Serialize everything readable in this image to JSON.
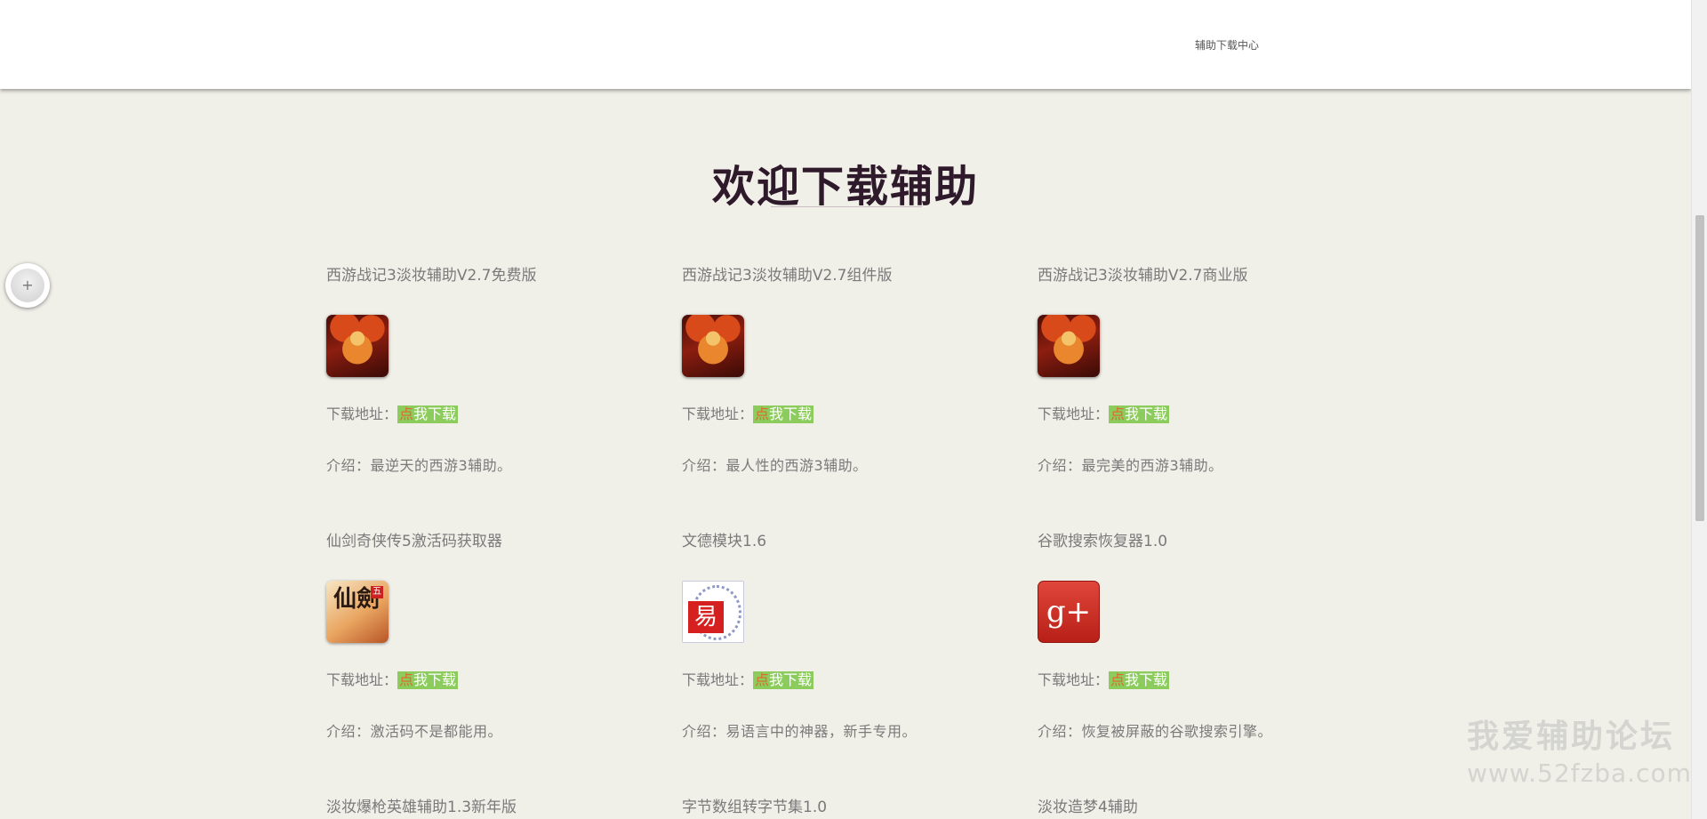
{
  "header": {
    "nav_link": "辅助下载中心"
  },
  "hero": {
    "title": "欢迎下载辅助"
  },
  "float_button": {
    "icon": "+"
  },
  "download_label": "下载地址：",
  "download_button_first": "点",
  "download_button_rest": "我下载",
  "items": [
    {
      "title": "西游战记3淡妆辅助V2.7免费版",
      "icon": "xiyou-monkey-icon",
      "intro": "介绍：最逆天的西游3辅助。"
    },
    {
      "title": "西游战记3淡妆辅助V2.7组件版",
      "icon": "xiyou-monkey-icon",
      "intro": "介绍：最人性的西游3辅助。"
    },
    {
      "title": "西游战记3淡妆辅助V2.7商业版",
      "icon": "xiyou-monkey-icon",
      "intro": "介绍：最完美的西游3辅助。"
    },
    {
      "title": "仙剑奇侠传5激活码获取器",
      "icon": "xianjian-icon",
      "intro": "介绍：激活码不是都能用。",
      "icon_text": "仙劍",
      "icon_badge": "五"
    },
    {
      "title": "文德模块1.6",
      "icon": "yi-language-icon",
      "intro": "介绍：易语言中的神器，新手专用。",
      "icon_text": "易"
    },
    {
      "title": "谷歌搜索恢复器1.0",
      "icon": "google-plus-icon",
      "intro": "介绍：恢复被屏蔽的谷歌搜索引擎。",
      "icon_text": "g+"
    },
    {
      "title": "淡妆爆枪英雄辅助1.3新年版"
    },
    {
      "title": "字节数组转字节集1.0"
    },
    {
      "title": "淡妆造梦4辅助"
    }
  ],
  "watermark": {
    "cn": "我爱辅助论坛",
    "url": "www.52fzba.com"
  },
  "colors": {
    "page_bg": "#f0efe8",
    "download_button_bg": "#8ccc5c",
    "download_button_first": "#e0682a",
    "title_text": "#2e1a2a"
  }
}
